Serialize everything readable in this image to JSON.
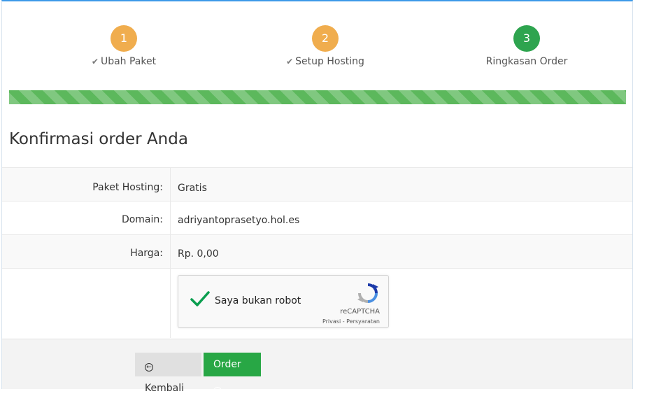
{
  "steps": [
    {
      "number": "1",
      "label": "Ubah Paket",
      "status": "done",
      "color": "#f0ad4e"
    },
    {
      "number": "2",
      "label": "Setup Hosting",
      "status": "done",
      "color": "#f0ad4e"
    },
    {
      "number": "3",
      "label": "Ringkasan Order",
      "status": "current",
      "color": "#2ea44f"
    }
  ],
  "progress": {
    "percent": 100,
    "color": "#5cb85c"
  },
  "page_title": "Konfirmasi order Anda",
  "summary": {
    "rows": [
      {
        "label": "Paket Hosting:",
        "value": "Gratis"
      },
      {
        "label": "Domain:",
        "value": "adriyantoprasetyo.hol.es"
      },
      {
        "label": "Harga:",
        "value": "Rp. 0,00"
      }
    ]
  },
  "captcha": {
    "label": "Saya bukan robot",
    "checked": true,
    "brand": "reCAPTCHA",
    "terms": "Privasi - Persyaratan",
    "icon": "recaptcha-logo-icon"
  },
  "footer": {
    "back_label": "Kembali",
    "back_icon": "circle-arrow-left-icon",
    "order_label": "Order",
    "order_icon": "circle-arrow-right-icon"
  }
}
